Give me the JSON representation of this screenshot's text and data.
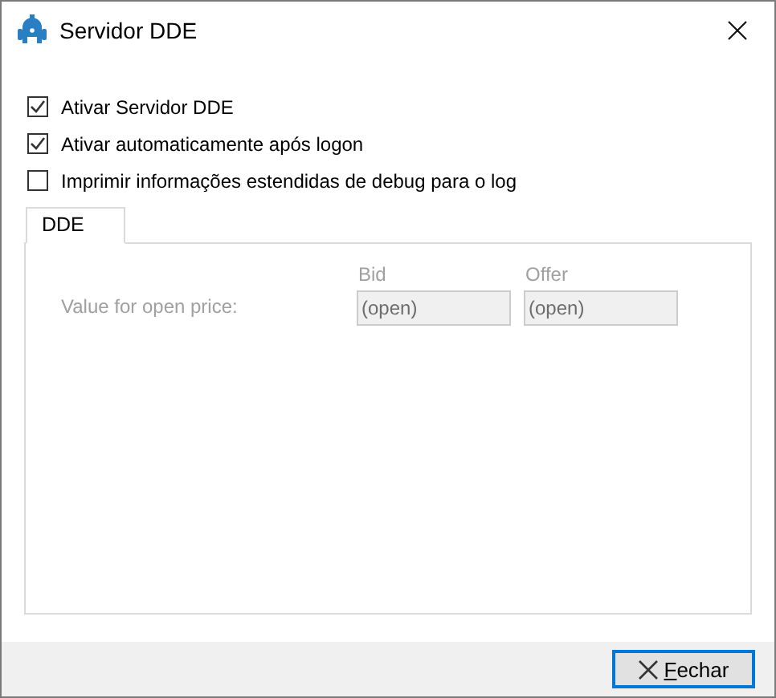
{
  "window": {
    "title": "Servidor DDE"
  },
  "options": [
    {
      "label": "Ativar Servidor DDE",
      "checked": true
    },
    {
      "label": "Ativar automaticamente após logon",
      "checked": true
    },
    {
      "label": "Imprimir informações estendidas de debug para o log",
      "checked": false
    }
  ],
  "tabs": [
    {
      "label": "DDE",
      "selected": true
    }
  ],
  "dde": {
    "disabled": true,
    "row_label": "Value for open price:",
    "columns": [
      {
        "heading": "Bid",
        "value": "(open)"
      },
      {
        "heading": "Offer",
        "value": "(open)"
      }
    ]
  },
  "buttons": [
    {
      "label": "Fechar"
    }
  ]
}
